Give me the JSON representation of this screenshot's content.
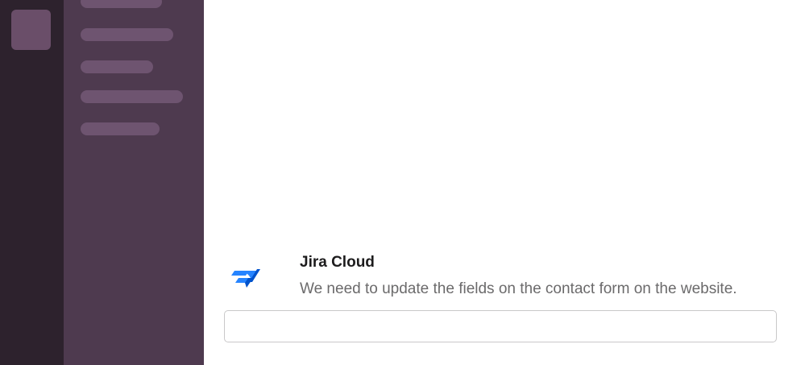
{
  "app": {
    "accent_color": "#4e3a4f",
    "rail_color": "#2d222d"
  },
  "message": {
    "sender": "Jira Cloud",
    "text": "We need to update the fields on the contact form on the website.",
    "icon": "jira-icon",
    "icon_colors": [
      "#2684ff",
      "#0052cc"
    ]
  },
  "composer": {
    "value": "",
    "placeholder": ""
  }
}
